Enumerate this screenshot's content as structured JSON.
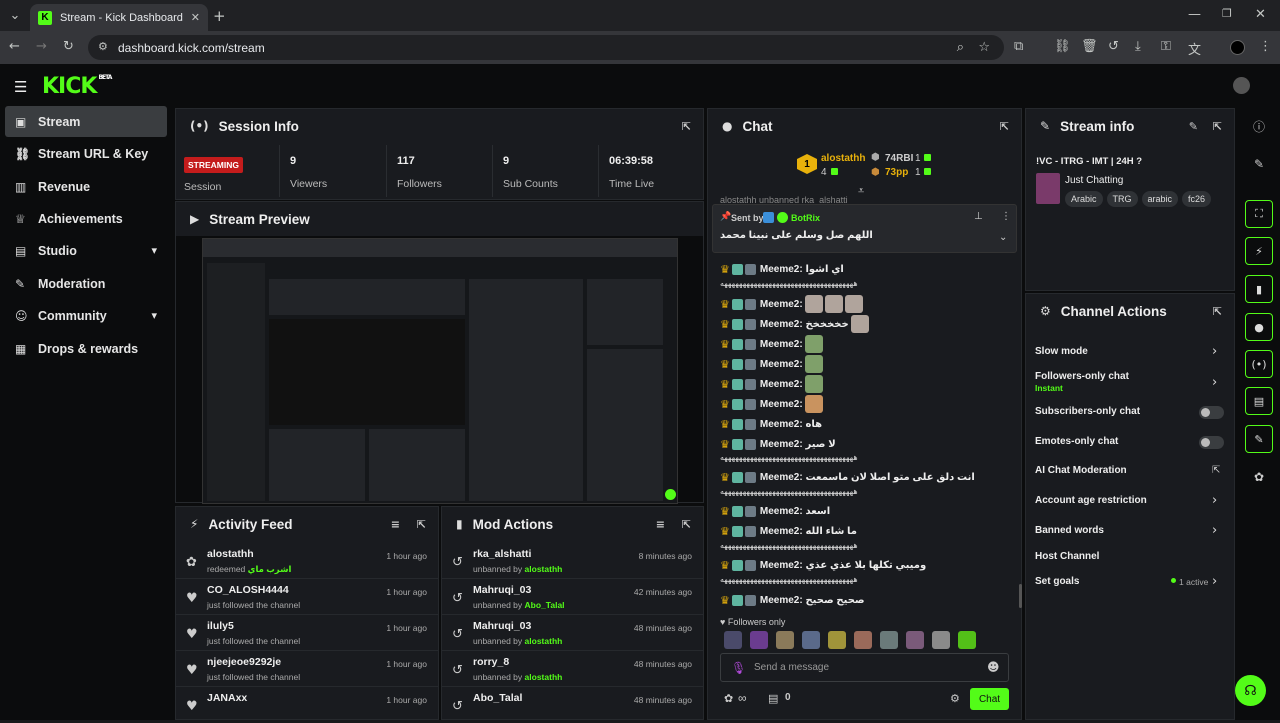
{
  "browser": {
    "tab_title": "Stream - Kick Dashboard",
    "favicon_letter": "K",
    "url": "dashboard.kick.com/stream"
  },
  "app": {
    "logo": "KICK",
    "logo_beta": "BETA",
    "accent": "#53fc18"
  },
  "sidebar": {
    "items": [
      {
        "label": "Stream",
        "icon": "layout-icon"
      },
      {
        "label": "Stream URL & Key",
        "icon": "link-icon"
      },
      {
        "label": "Revenue",
        "icon": "chart-icon"
      },
      {
        "label": "Achievements",
        "icon": "trophy-icon"
      },
      {
        "label": "Studio",
        "icon": "studio-icon"
      },
      {
        "label": "Moderation",
        "icon": "wrench-icon"
      },
      {
        "label": "Community",
        "icon": "community-icon"
      },
      {
        "label": "Drops & rewards",
        "icon": "gift-icon"
      }
    ]
  },
  "session": {
    "title": "Session Info",
    "status": "STREAMING",
    "status_label": "Session",
    "stats": [
      {
        "value": "9",
        "label": "Viewers"
      },
      {
        "value": "117",
        "label": "Followers"
      },
      {
        "value": "9",
        "label": "Sub Counts"
      },
      {
        "value": "06:39:58",
        "label": "Time Live"
      }
    ]
  },
  "preview": {
    "title": "Stream Preview"
  },
  "activity": {
    "title": "Activity Feed",
    "items": [
      {
        "name": "alostathh",
        "sub": "redeemed",
        "extra": "اشرب ماي",
        "time": "1 hour ago"
      },
      {
        "name": "CO_ALOSH4444",
        "sub": "just followed the channel",
        "time": "1 hour ago"
      },
      {
        "name": "iluly5",
        "sub": "just followed the channel",
        "time": "1 hour ago"
      },
      {
        "name": "njeejeoe9292je",
        "sub": "just followed the channel",
        "time": "1 hour ago"
      },
      {
        "name": "JANAxx",
        "sub": "",
        "time": "1 hour ago"
      }
    ]
  },
  "mod": {
    "title": "Mod Actions",
    "items": [
      {
        "name": "rka_alshatti",
        "sub": "unbanned by",
        "by": "alostathh",
        "time": "8 minutes ago"
      },
      {
        "name": "Mahruqi_03",
        "sub": "unbanned by",
        "by": "Abo_Talal",
        "time": "42 minutes ago"
      },
      {
        "name": "Mahruqi_03",
        "sub": "unbanned by",
        "by": "alostathh",
        "time": "48 minutes ago"
      },
      {
        "name": "rorry_8",
        "sub": "unbanned by",
        "by": "alostathh",
        "time": "48 minutes ago"
      },
      {
        "name": "Abo_Talal",
        "sub": "",
        "by": "",
        "time": "48 minutes ago"
      }
    ]
  },
  "chat": {
    "title": "Chat",
    "leader1_rank": "1",
    "leader1_name": "alostathh",
    "leader1_count": "4",
    "leader2_name": "74RBI",
    "leader2_count": "1",
    "leader3_name": "73pp",
    "leader3_count": "1",
    "truncated_line": "alostathh unbanned rka_alshatti",
    "pinned_by_label": "Sent by",
    "pinned_by": "BotRix",
    "pinned_text": "اللهم صل وسلم على نبينا محمد",
    "messages": [
      {
        "user": "Meeme2:",
        "text": "اي اشوا"
      },
      {
        "user": "",
        "text": "ههههههههههههههههههههههههههههههههههههه"
      },
      {
        "user": "Meeme2:",
        "text": ""
      },
      {
        "user": "Meeme2:",
        "text": "خخخخخخ"
      },
      {
        "user": "Meeme2:",
        "text": ""
      },
      {
        "user": "Meeme2:",
        "text": ""
      },
      {
        "user": "Meeme2:",
        "text": ""
      },
      {
        "user": "Meeme2:",
        "text": ""
      },
      {
        "user": "Meeme2:",
        "text": "هاه"
      },
      {
        "user": "Meeme2:",
        "text": "لا صير"
      },
      {
        "user": "",
        "text": "ههههههههههههههههههههههههههههههههههههه"
      },
      {
        "user": "Meeme2:",
        "text": "انت دلق على متو اصلا لان ماسمعت"
      },
      {
        "user": "",
        "text": "ههههههههههههههههههههههههههههههههههههه"
      },
      {
        "user": "Meeme2:",
        "text": "اسعد"
      },
      {
        "user": "Meeme2:",
        "text": "ما شاء الله"
      },
      {
        "user": "",
        "text": "ههههههههههههههههههههههههههههههههههههه"
      },
      {
        "user": "Meeme2:",
        "text": "وميبي تكلها بلا عذي عذي"
      },
      {
        "user": "",
        "text": "ههههههههههههههههههههههههههههههههههههه"
      },
      {
        "user": "Meeme2:",
        "text": "صحيح صحيح"
      }
    ],
    "followers_only": "Followers only",
    "input_placeholder": "Send a message",
    "infinity": "∞",
    "points": "0",
    "send_button": "Chat"
  },
  "stream_info": {
    "title": "Stream info",
    "stream_title": "!VC - ITRG - IMT | 24H ?",
    "category": "Just Chatting",
    "tags": [
      "Arabic",
      "TRG",
      "arabic",
      "fc26"
    ]
  },
  "channel_actions": {
    "title": "Channel Actions",
    "slow_mode": "Slow mode",
    "followers_only": "Followers-only chat",
    "followers_only_value": "Instant",
    "subs_only": "Subscribers-only chat",
    "emotes_only": "Emotes-only chat",
    "ai_mod": "AI Chat Moderation",
    "age": "Account age restriction",
    "banned": "Banned words",
    "host": "Host Channel",
    "goals": "Set goals",
    "goals_value": "1 active"
  }
}
